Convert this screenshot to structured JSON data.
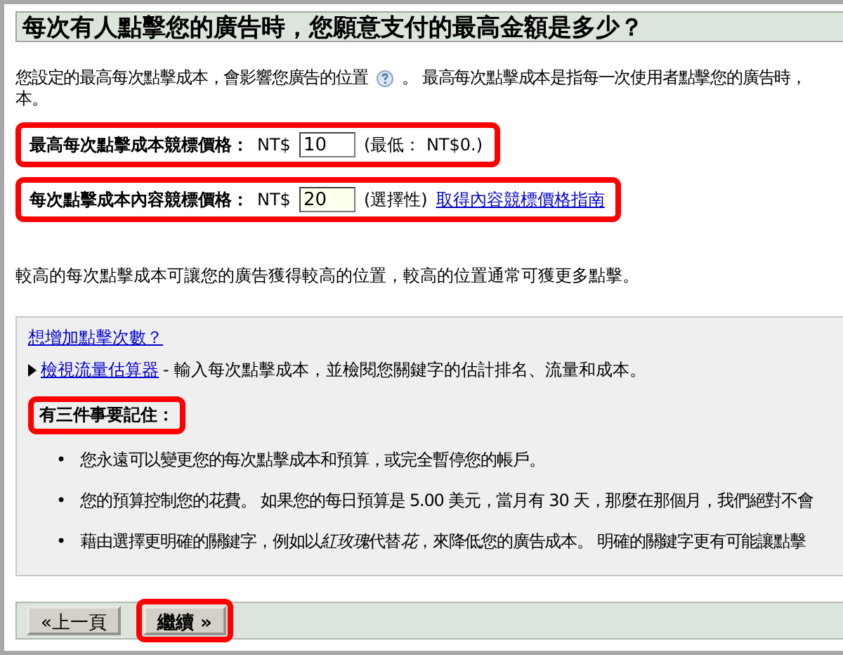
{
  "heading": "每次有人點擊您的廣告時，您願意支付的最高金額是多少？",
  "intro": {
    "before_icon": "您設定的最高每次點擊成本，會影響您廣告的位置",
    "after_icon": "。 最高每次點擊成本是指每一次使用者點擊您的廣告時，",
    "continuation": "本。"
  },
  "bids": [
    {
      "label": "最高每次點擊成本競標價格：",
      "currency": "NT$",
      "value": "10",
      "note": "(最低： NT$0.)",
      "kind": "required",
      "highlighted": true
    },
    {
      "label": "每次點擊成本內容競標價格：",
      "currency": "NT$",
      "value": "20",
      "note": "(選擇性)",
      "link": "取得內容競標價格指南",
      "kind": "optional",
      "highlighted": true
    }
  ],
  "explanation": "較高的每次點擊成本可讓您的廣告獲得較高的位置，較高的位置通常可獲更多點擊。",
  "tips": {
    "link": "想增加點擊次數？",
    "tool_link": "檢視流量估算器",
    "tool_text": "- 輸入每次點擊成本，並檢閱您關鍵字的估計排名、流量和成本。",
    "remember_title": "有三件事要記住：",
    "remember_highlighted": true,
    "marker": "•",
    "bullets": [
      [
        {
          "text": "您永遠可以變更您的每次點擊成本和預算，或完全暫停您的帳戶。",
          "italic": false
        }
      ],
      [
        {
          "text": "您的預算控制您的花費。 如果您的每日預算是 5.00 美元，當月有 30 天，那麼在那個月，我們絕對不會",
          "italic": false
        }
      ],
      [
        {
          "text": "藉由選擇更明確的關鍵字，例如以",
          "italic": false
        },
        {
          "text": "紅玫瑰",
          "italic": true
        },
        {
          "text": "代替",
          "italic": false
        },
        {
          "text": "花",
          "italic": true
        },
        {
          "text": "，來降低您的廣告成本。 明確的關鍵字更有可能讓點擊",
          "italic": false
        }
      ]
    ]
  },
  "buttons": [
    {
      "label": "«上一頁",
      "kind": "back",
      "highlighted": false
    },
    {
      "label": "繼續 »",
      "kind": "continue",
      "highlighted": true
    }
  ]
}
